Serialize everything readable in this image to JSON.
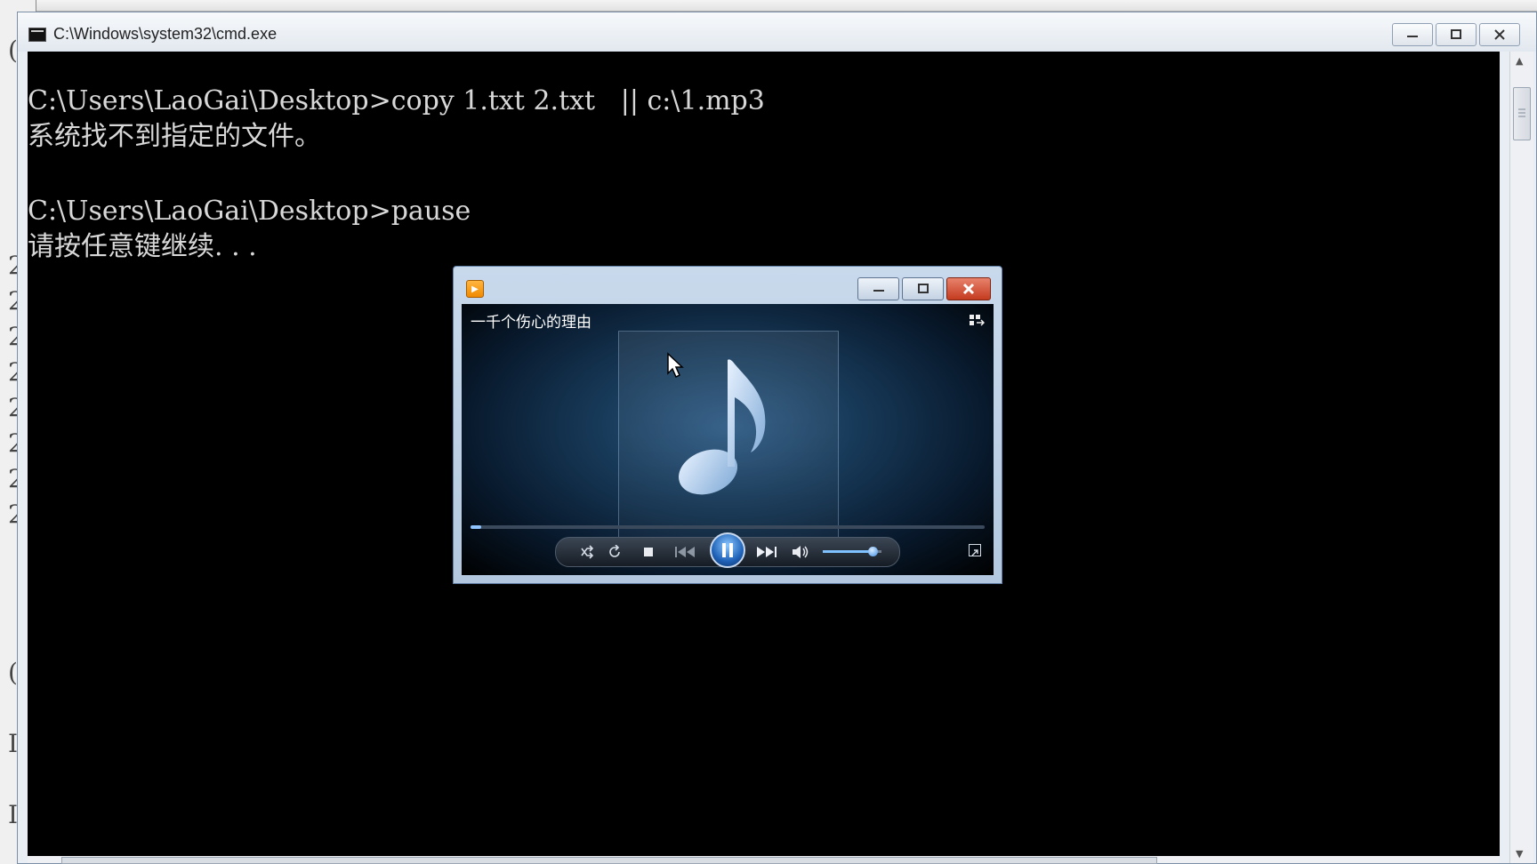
{
  "background_window": {
    "visible_chars": [
      "(",
      "2",
      "2",
      "2",
      "2",
      "2",
      "2",
      "2",
      "2",
      "(",
      "I",
      "I"
    ]
  },
  "cmd_window": {
    "title": "C:\\Windows\\system32\\cmd.exe",
    "minimize_icon": "minimize-icon",
    "maximize_icon": "maximize-icon",
    "close_icon": "close-icon",
    "lines": [
      "C:\\Users\\LaoGai\\Desktop>copy 1.txt 2.txt   || c:\\1.mp3",
      "系统找不到指定的文件。",
      "",
      "C:\\Users\\LaoGai\\Desktop>pause",
      "请按任意键继续. . ."
    ]
  },
  "media_player": {
    "app_icon": "media-player-icon",
    "track_title": "一千个伤心的理由",
    "switch_view_icon": "switch-to-library-icon",
    "album_art_icon": "music-note-icon",
    "progress": 0.02,
    "volume": 0.85,
    "controls": {
      "shuffle_icon": "shuffle-icon",
      "repeat_icon": "repeat-icon",
      "stop_icon": "stop-icon",
      "previous_icon": "previous-icon",
      "pause_icon": "pause-icon",
      "next_icon": "next-icon",
      "mute_icon": "speaker-icon"
    },
    "fullscreen_icon": "fullscreen-icon"
  },
  "colors": {
    "console_bg": "#000000",
    "console_text": "#d8d8d8",
    "accent": "#1f62b8",
    "close_red": "#c43b1f"
  }
}
